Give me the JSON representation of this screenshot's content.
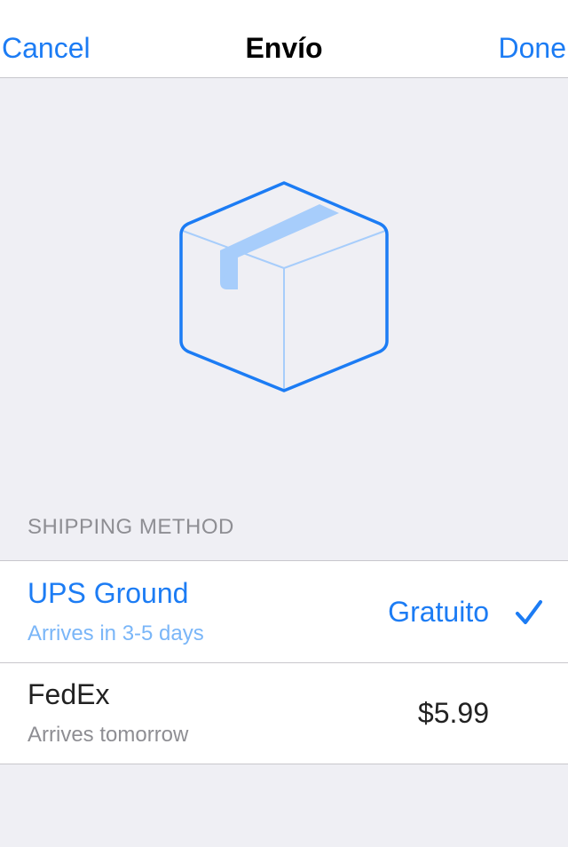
{
  "navbar": {
    "cancel_label": "Cancel",
    "title": "Envío",
    "done_label": "Done"
  },
  "hero": {
    "icon": "package-box-icon",
    "accent_color": "#1c7cf4",
    "tape_color": "#a7cdfb"
  },
  "shipping": {
    "section_header": "SHIPPING METHOD",
    "methods": [
      {
        "name": "UPS Ground",
        "delivery": "Arrives in 3-5 days",
        "price": "Gratuito",
        "selected": true,
        "check_icon": "checkmark-icon"
      },
      {
        "name": "FedEx",
        "delivery": "Arrives tomorrow",
        "price": "$5.99",
        "selected": false
      }
    ]
  },
  "colors": {
    "tint": "#1c7cf4",
    "background": "#efeff4",
    "separator": "#c8c7cc",
    "secondary_text": "#8e8e93"
  }
}
